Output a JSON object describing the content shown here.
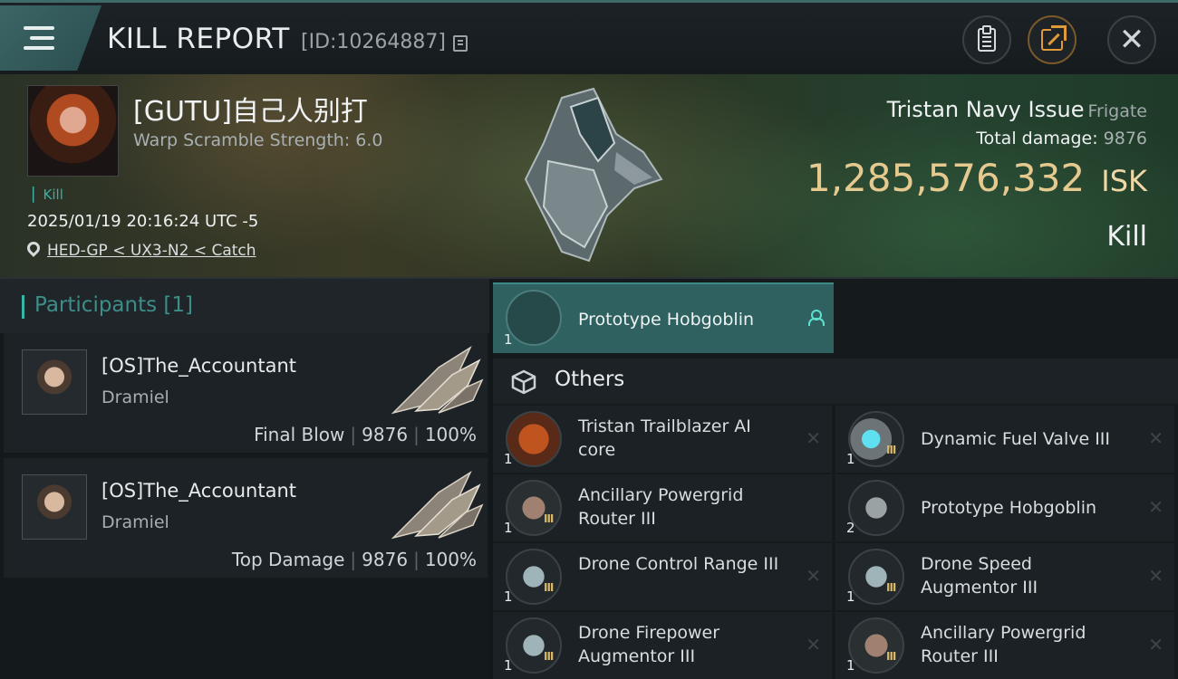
{
  "header": {
    "title": "KILL REPORT",
    "report_id": "[ID:10264887]"
  },
  "victim": {
    "name": "[GUTU]自己人别打",
    "warp_strength": "Warp Scramble Strength: 6.0",
    "kill_tag": "Kill",
    "datetime": "2025/01/19 20:16:24 UTC -5",
    "location": "HED-GP < UX3-N2 < Catch",
    "ship_name": "Tristan Navy Issue",
    "ship_class": "Frigate",
    "total_damage_label": "Total damage:",
    "total_damage": "9876",
    "isk_value": "1,285,576,332",
    "isk_unit": "ISK",
    "result": "Kill"
  },
  "participants": {
    "title": "Participants [1]",
    "list": [
      {
        "name": "[OS]The_Accountant",
        "ship": "Dramiel",
        "role": "Final Blow",
        "damage": "9876",
        "percent": "100%"
      },
      {
        "name": "[OS]The_Accountant",
        "ship": "Dramiel",
        "role": "Top Damage",
        "damage": "9876",
        "percent": "100%"
      }
    ]
  },
  "items": {
    "drone_bay": {
      "qty": "1",
      "name": "Prototype  Hobgoblin"
    },
    "others_label": "Others",
    "list": [
      {
        "qty": "1",
        "name": "Tristan Trailblazer AI core",
        "tier": ""
      },
      {
        "qty": "1",
        "name": "Dynamic Fuel Valve III",
        "tier": "III"
      },
      {
        "qty": "1",
        "name": "Ancillary Powergrid Router III",
        "tier": "III"
      },
      {
        "qty": "2",
        "name": "Prototype  Hobgoblin",
        "tier": ""
      },
      {
        "qty": "1",
        "name": "Drone Control Range III",
        "tier": "III"
      },
      {
        "qty": "1",
        "name": "Drone Speed Augmentor III",
        "tier": "III"
      },
      {
        "qty": "1",
        "name": "Drone Firepower Augmentor III",
        "tier": "III"
      },
      {
        "qty": "1",
        "name": "Ancillary Powergrid Router III",
        "tier": "III"
      }
    ]
  },
  "colors": {
    "accent": "#38b5a8",
    "isk": "#e6c98f",
    "share": "#e09a3a"
  }
}
